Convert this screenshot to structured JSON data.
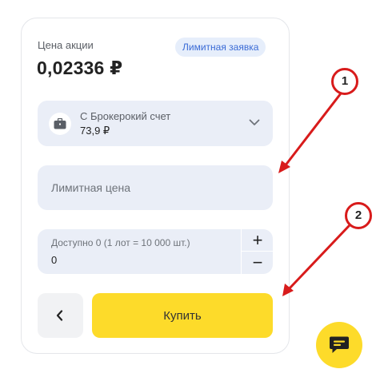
{
  "order_form": {
    "price_label": "Цена акции",
    "price_value": "0,02336 ₽",
    "order_type_badge": "Лимитная заявка",
    "account": {
      "name": "С Брокерокий счет",
      "balance": "73,9 ₽",
      "icon": "briefcase-icon"
    },
    "limit_price": {
      "value": "",
      "placeholder": "Лимитная цена"
    },
    "quantity": {
      "caption": "Доступно 0 (1 лот = 10 000 шт.)",
      "value": "0",
      "plus_label": "+",
      "minus_label": "−"
    },
    "back_icon": "chevron-left-icon",
    "buy_label": "Купить"
  },
  "annotations": [
    {
      "label": "1"
    },
    {
      "label": "2"
    }
  ],
  "chat": {
    "icon": "chat-bubble-icon"
  },
  "colors": {
    "accent_yellow": "#fddb2a",
    "field_bg": "#eaeef7",
    "badge_bg": "#e6eefb",
    "badge_text": "#3a6bd6",
    "annotation_red": "#d81b1b"
  }
}
